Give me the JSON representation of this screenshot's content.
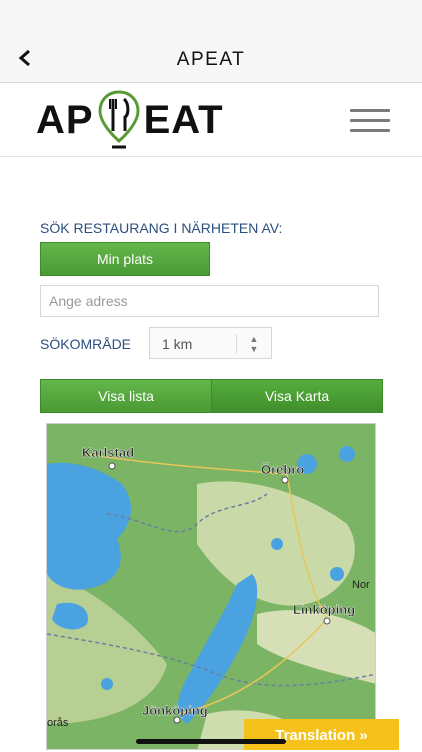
{
  "nav": {
    "back_icon": "chevron-left-icon",
    "title": "APEAT"
  },
  "header": {
    "logo_left": "AP",
    "logo_right": "EAT",
    "menu_icon": "hamburger-icon",
    "brand_color": "#5a9a36"
  },
  "search": {
    "label": "SÖK RESTAURANG I NÄRHETEN AV:",
    "my_location_button": "Min plats",
    "address_placeholder": "Ange adress",
    "area_label": "SÖKOMRÅDE",
    "area_value": "1 km"
  },
  "view_toggle": {
    "list_label": "Visa lista",
    "map_label": "Visa Karta"
  },
  "map": {
    "places": {
      "karlstad": "Karlstad",
      "orebro": "Örebro",
      "linkoping": "Linköping",
      "jonkoping": "Jönköping",
      "nor": "Nor",
      "boras": "orås"
    }
  },
  "translation_button": "Translation »"
}
